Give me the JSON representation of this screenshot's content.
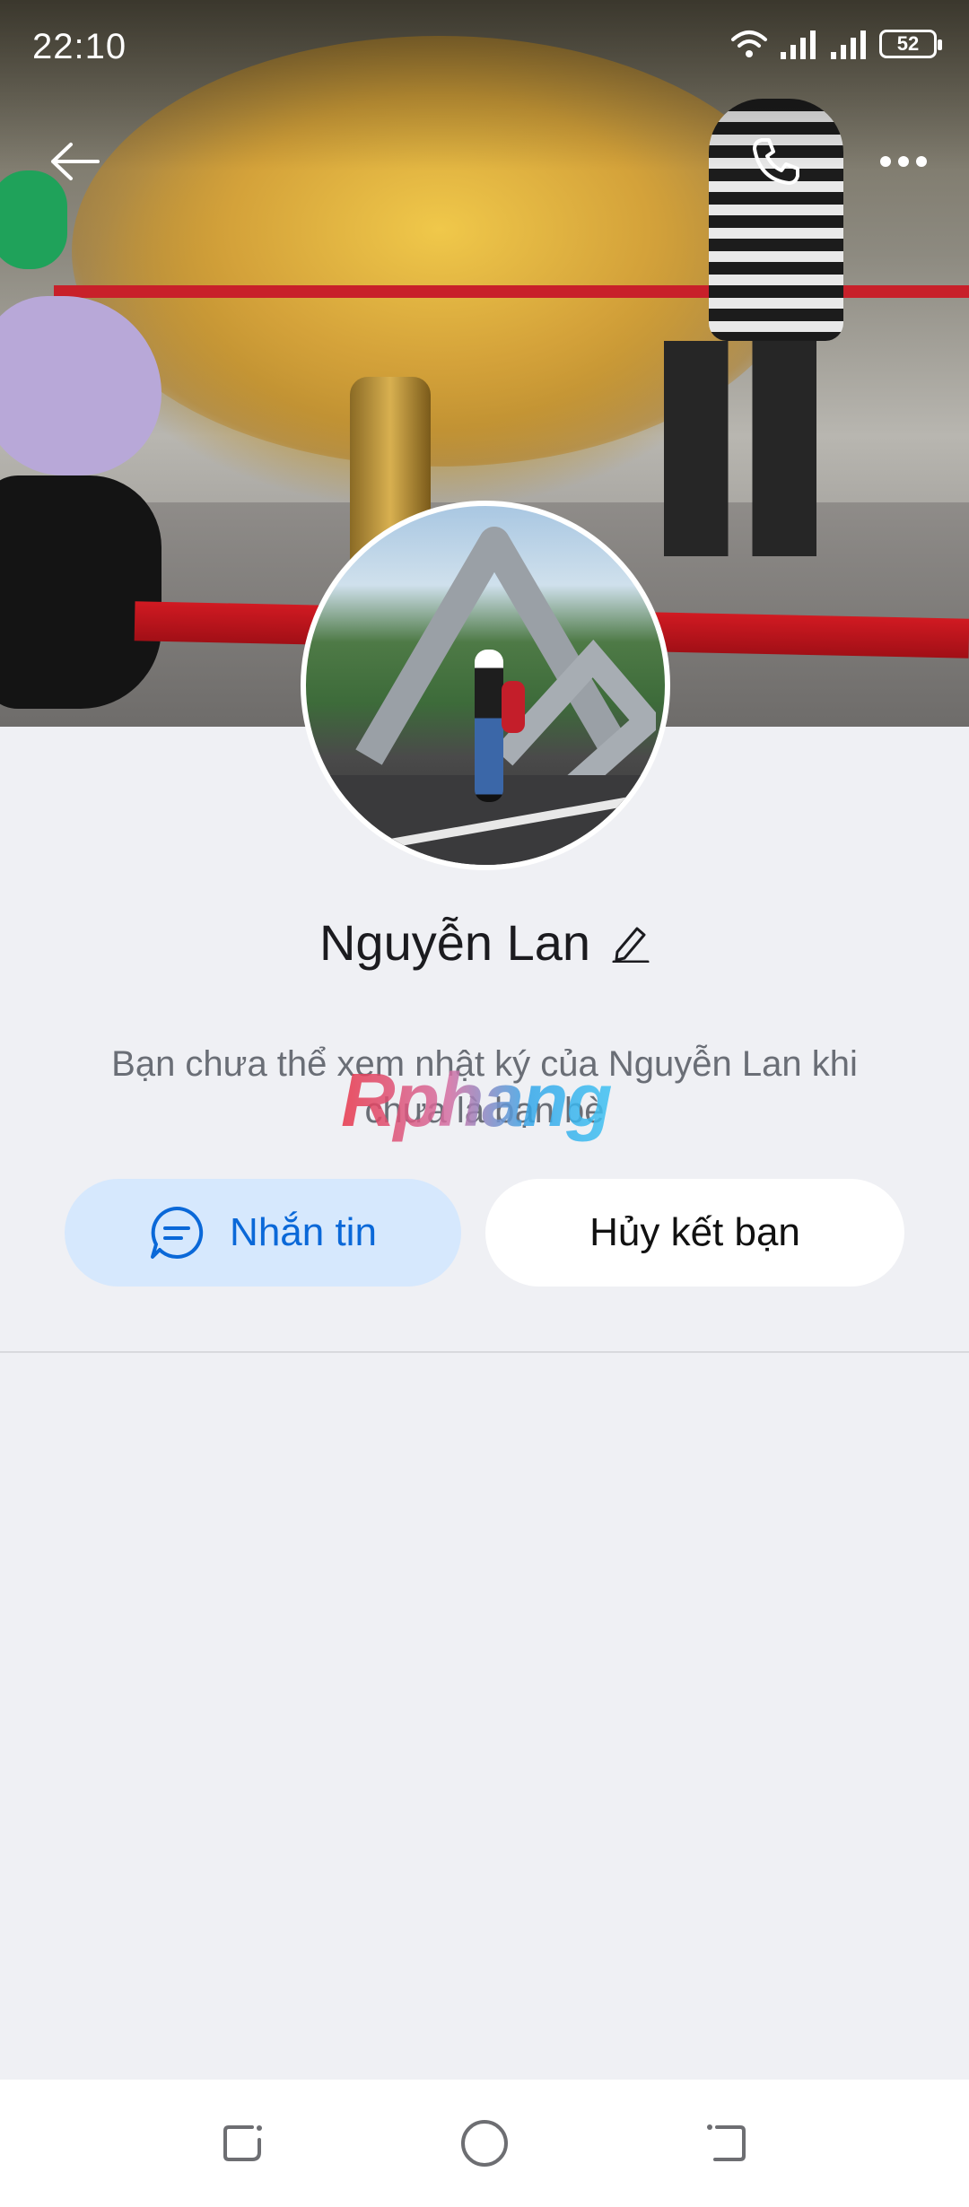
{
  "status_bar": {
    "time": "22:10",
    "battery": "52"
  },
  "profile": {
    "name": "Nguyễn Lan",
    "notice": "Bạn chưa thể xem nhật ký của Nguyễn Lan khi chưa là bạn bè"
  },
  "actions": {
    "message_label": "Nhắn tin",
    "unfriend_label": "Hủy kết bạn"
  },
  "watermark": "Rphang",
  "icons": {
    "back": "back-arrow-icon",
    "call": "phone-icon",
    "more": "more-dots-icon",
    "edit": "pencil-icon",
    "chat": "chat-bubble-icon"
  },
  "colors": {
    "accent": "#0a68d8",
    "message_button_bg": "#d6e8fd",
    "page_bg": "#eff0f4"
  }
}
